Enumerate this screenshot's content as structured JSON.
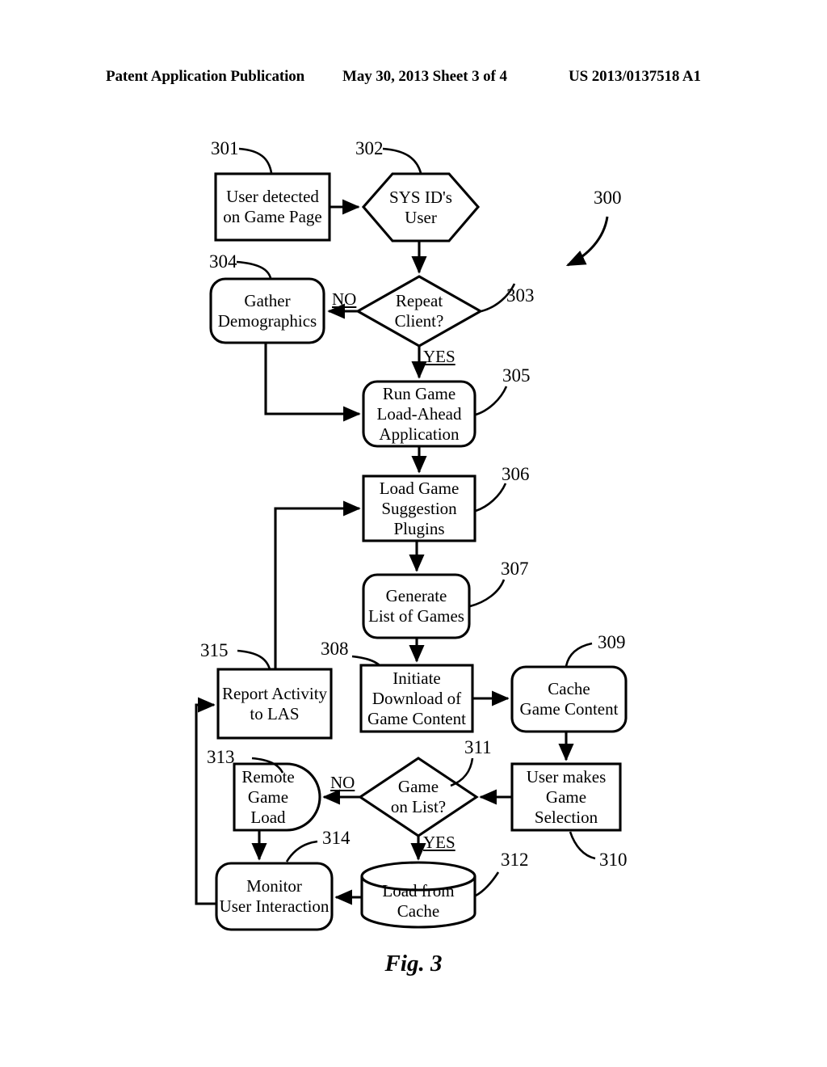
{
  "header": {
    "left": "Patent Application Publication",
    "middle": "May 30, 2013  Sheet 3 of 4",
    "right": "US 2013/0137518 A1"
  },
  "caption": "Fig. 3",
  "figure": {
    "overall_ref": "300",
    "nodes": [
      {
        "ref": "301",
        "text": "User detected\non Game Page",
        "shape": "rect"
      },
      {
        "ref": "302",
        "text": "SYS ID's\nUser",
        "shape": "hexagon"
      },
      {
        "ref": "303",
        "text": "Repeat\nClient?",
        "shape": "diamond"
      },
      {
        "ref": "304",
        "text": "Gather\nDemographics",
        "shape": "rounded-rect"
      },
      {
        "ref": "305",
        "text": "Run Game\nLoad-Ahead\nApplication",
        "shape": "rounded-rect"
      },
      {
        "ref": "306",
        "text": "Load Game\nSuggestion\nPlugins",
        "shape": "rect"
      },
      {
        "ref": "307",
        "text": "Generate\nList of Games",
        "shape": "rounded-rect"
      },
      {
        "ref": "308",
        "text": "Initiate\nDownload of\nGame Content",
        "shape": "rect"
      },
      {
        "ref": "309",
        "text": "Cache\nGame Content",
        "shape": "rounded-rect"
      },
      {
        "ref": "310",
        "text": "User makes\nGame\nSelection",
        "shape": "rect"
      },
      {
        "ref": "311",
        "text": "Game\non List?",
        "shape": "diamond"
      },
      {
        "ref": "312",
        "text": "Load from\nCache",
        "shape": "cylinder"
      },
      {
        "ref": "313",
        "text": "Remote\nGame\nLoad",
        "shape": "d-shape"
      },
      {
        "ref": "314",
        "text": "Monitor\nUser Interaction",
        "shape": "rounded-rect"
      },
      {
        "ref": "315",
        "text": "Report Activity\nto LAS",
        "shape": "rect"
      }
    ],
    "edge_labels": [
      {
        "id": "no-repeat-client",
        "text": "NO"
      },
      {
        "id": "yes-repeat-client",
        "text": "YES"
      },
      {
        "id": "no-game-on-list",
        "text": "NO"
      },
      {
        "id": "yes-game-on-list",
        "text": "YES"
      }
    ]
  },
  "colors": {
    "ink": "#000000",
    "paper": "#ffffff"
  }
}
